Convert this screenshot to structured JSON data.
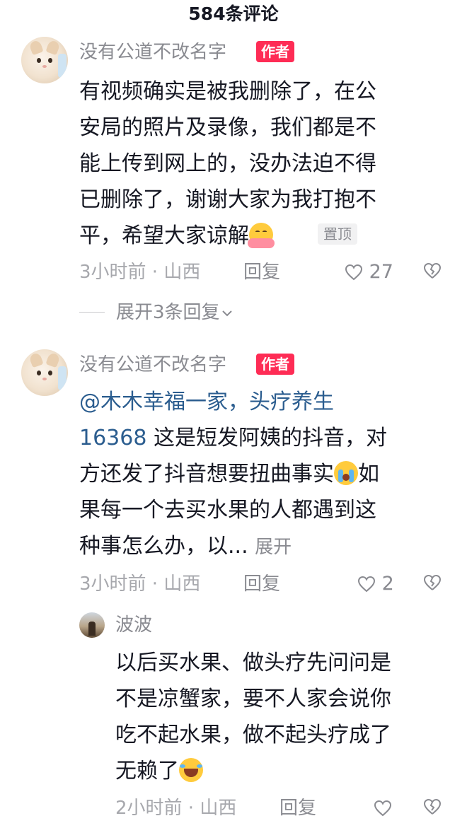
{
  "header": {
    "title": "584条评论"
  },
  "comments": [
    {
      "username": "没有公道不改名字",
      "badge": "作者",
      "lines": [
        "有视频确实是被我删除了，在公",
        "安局的照片及录像，我们都是不",
        "能上传到网上的，没办法迫不得",
        "已删除了，谢谢大家为我打抱不",
        "平，希望大家谅解"
      ],
      "emoji": "hug-emoji",
      "pinned": "置顶",
      "time_location": "3小时前 · 山西",
      "reply_label": "回复",
      "likes": "27",
      "expand_replies": "展开3条回复"
    },
    {
      "username": "没有公道不改名字",
      "badge": "作者",
      "mention_line1": "@木木幸福一家，头疗养生",
      "mention_line2_prefix": "16368",
      "lines": [
        " 这是短发阿姨的抖音，对",
        "方还发了抖音想要扭曲事实",
        "如",
        "果每一个去买水果的人都遇到这",
        "种事怎么办，以..."
      ],
      "emoji": "crying-emoji",
      "expand_label": "展开",
      "time_location": "3小时前 · 山西",
      "reply_label": "回复",
      "likes": "2"
    }
  ],
  "reply": {
    "username": "波波",
    "lines": [
      "以后买水果、做头疗先问问是",
      "不是凉蟹家，要不人家会说你",
      "吃不起水果，做不起头疗成了",
      "无赖了"
    ],
    "emoji": "laughing-emoji",
    "time_location": "2小时前 · 山西",
    "reply_label": "回复",
    "likes": ""
  },
  "colors": {
    "author_badge": "#fe2c55",
    "mention": "#2b5d8f",
    "meta": "#a7a8ad"
  }
}
